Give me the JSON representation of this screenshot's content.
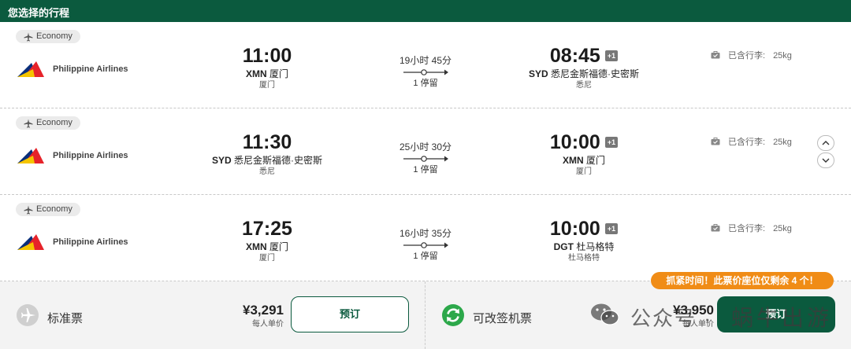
{
  "header": {
    "title": "您选择的行程"
  },
  "flights": [
    {
      "cabin": "Economy",
      "airline": "Philippine Airlines",
      "dep_time": "11:00",
      "dep_code": "XMN",
      "dep_airport": "厦门",
      "dep_city": "厦门",
      "duration": "19小时 45分",
      "stops": "1 停留",
      "arr_time": "08:45",
      "arr_plus": "+1",
      "arr_code": "SYD",
      "arr_airport": "悉尼金斯福德·史密斯",
      "arr_city": "悉尼",
      "baggage_label": "已含行李:",
      "baggage_weight": "25kg"
    },
    {
      "cabin": "Economy",
      "airline": "Philippine Airlines",
      "dep_time": "11:30",
      "dep_code": "SYD",
      "dep_airport": "悉尼金斯福德·史密斯",
      "dep_city": "悉尼",
      "duration": "25小时 30分",
      "stops": "1 停留",
      "arr_time": "10:00",
      "arr_plus": "+1",
      "arr_code": "XMN",
      "arr_airport": "厦门",
      "arr_city": "厦门",
      "baggage_label": "已含行李:",
      "baggage_weight": "25kg"
    },
    {
      "cabin": "Economy",
      "airline": "Philippine Airlines",
      "dep_time": "17:25",
      "dep_code": "XMN",
      "dep_airport": "厦门",
      "dep_city": "厦门",
      "duration": "16小时 35分",
      "stops": "1 停留",
      "arr_time": "10:00",
      "arr_plus": "+1",
      "arr_code": "DGT",
      "arr_airport": "杜马格特",
      "arr_city": "杜马格特",
      "baggage_label": "已含行李:",
      "baggage_weight": "25kg"
    }
  ],
  "fares": [
    {
      "label": "标准票",
      "price": "¥3,291",
      "per_unit": "每人单价",
      "button": "预订"
    },
    {
      "label": "可改签机票",
      "price": "¥3,950",
      "per_unit": "每人单价",
      "button": "预订"
    }
  ],
  "promo": "抓紧时间！此票价座位仅剩余 4 个！",
  "watermark": {
    "left": "公众号 ·",
    "right": "蜗牛出游"
  },
  "colors": {
    "brand": "#0b5a3e",
    "promo": "#f08c16",
    "refresh": "#2ca84a"
  }
}
